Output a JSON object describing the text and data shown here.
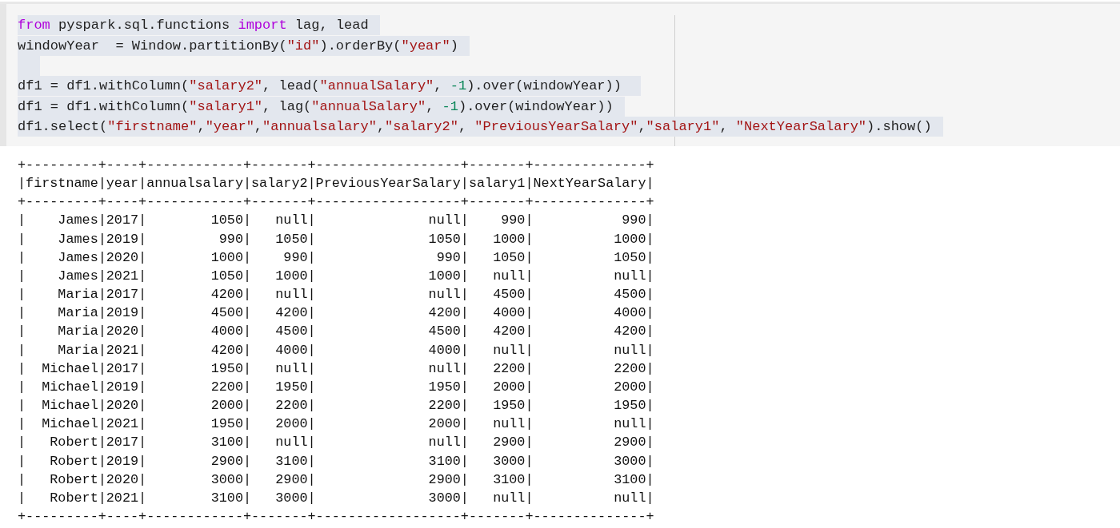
{
  "code_cell": {
    "lines": [
      {
        "selected": true,
        "tokens": [
          {
            "kind": "keyword",
            "text": "from"
          },
          {
            "kind": "plain",
            "text": " pyspark.sql.functions "
          },
          {
            "kind": "keyword",
            "text": "import"
          },
          {
            "kind": "plain",
            "text": " lag, lead"
          }
        ]
      },
      {
        "selected": true,
        "tokens": [
          {
            "kind": "plain",
            "text": "windowYear  = Window.partitionBy("
          },
          {
            "kind": "string",
            "text": "\"id\""
          },
          {
            "kind": "plain",
            "text": ").orderBy("
          },
          {
            "kind": "string",
            "text": "\"year\""
          },
          {
            "kind": "plain",
            "text": ")"
          }
        ]
      },
      {
        "selected": true
      },
      {
        "selected": true,
        "tokens": [
          {
            "kind": "plain",
            "text": "df1 = df1.withColumn("
          },
          {
            "kind": "string",
            "text": "\"salary2\""
          },
          {
            "kind": "plain",
            "text": ", lead("
          },
          {
            "kind": "string",
            "text": "\"annualSalary\""
          },
          {
            "kind": "plain",
            "text": ", "
          },
          {
            "kind": "number",
            "text": "-1"
          },
          {
            "kind": "plain",
            "text": ").over(windowYear)) "
          }
        ]
      },
      {
        "selected": true,
        "tokens": [
          {
            "kind": "plain",
            "text": "df1 = df1.withColumn("
          },
          {
            "kind": "string",
            "text": "\"salary1\""
          },
          {
            "kind": "plain",
            "text": ", lag("
          },
          {
            "kind": "string",
            "text": "\"annualSalary\""
          },
          {
            "kind": "plain",
            "text": ", "
          },
          {
            "kind": "number",
            "text": "-1"
          },
          {
            "kind": "plain",
            "text": ").over(windowYear))"
          }
        ]
      },
      {
        "selected": true,
        "tokens": [
          {
            "kind": "plain",
            "text": "df1.select("
          },
          {
            "kind": "string",
            "text": "\"firstname\""
          },
          {
            "kind": "plain",
            "text": ","
          },
          {
            "kind": "string",
            "text": "\"year\""
          },
          {
            "kind": "plain",
            "text": ","
          },
          {
            "kind": "string",
            "text": "\"annualsalary\""
          },
          {
            "kind": "plain",
            "text": ","
          },
          {
            "kind": "string",
            "text": "\"salary2\""
          },
          {
            "kind": "plain",
            "text": ", "
          },
          {
            "kind": "string",
            "text": "\"PreviousYearSalary\""
          },
          {
            "kind": "plain",
            "text": ","
          },
          {
            "kind": "string",
            "text": "\"salary1\""
          },
          {
            "kind": "plain",
            "text": ", "
          },
          {
            "kind": "string",
            "text": "\"NextYearSalary\""
          },
          {
            "kind": "plain",
            "text": ").show()"
          }
        ]
      }
    ]
  },
  "output": {
    "lines": [
      "+---------+----+------------+-------+------------------+-------+--------------+",
      "|firstname|year|annualsalary|salary2|PreviousYearSalary|salary1|NextYearSalary|",
      "+---------+----+------------+-------+------------------+-------+--------------+",
      "|    James|2017|        1050|   null|              null|    990|           990|",
      "|    James|2019|         990|   1050|              1050|   1000|          1000|",
      "|    James|2020|        1000|    990|               990|   1050|          1050|",
      "|    James|2021|        1050|   1000|              1000|   null|          null|",
      "|    Maria|2017|        4200|   null|              null|   4500|          4500|",
      "|    Maria|2019|        4500|   4200|              4200|   4000|          4000|",
      "|    Maria|2020|        4000|   4500|              4500|   4200|          4200|",
      "|    Maria|2021|        4200|   4000|              4000|   null|          null|",
      "|  Michael|2017|        1950|   null|              null|   2200|          2200|",
      "|  Michael|2019|        2200|   1950|              1950|   2000|          2000|",
      "|  Michael|2020|        2000|   2200|              2200|   1950|          1950|",
      "|  Michael|2021|        1950|   2000|              2000|   null|          null|",
      "|   Robert|2017|        3100|   null|              null|   2900|          2900|",
      "|   Robert|2019|        2900|   3100|              3100|   3000|          3000|",
      "|   Robert|2020|        3000|   2900|              2900|   3100|          3100|",
      "|   Robert|2021|        3100|   3000|              3000|   null|          null|",
      "+---------+----+------------+-------+------------------+-------+--------------+"
    ]
  }
}
